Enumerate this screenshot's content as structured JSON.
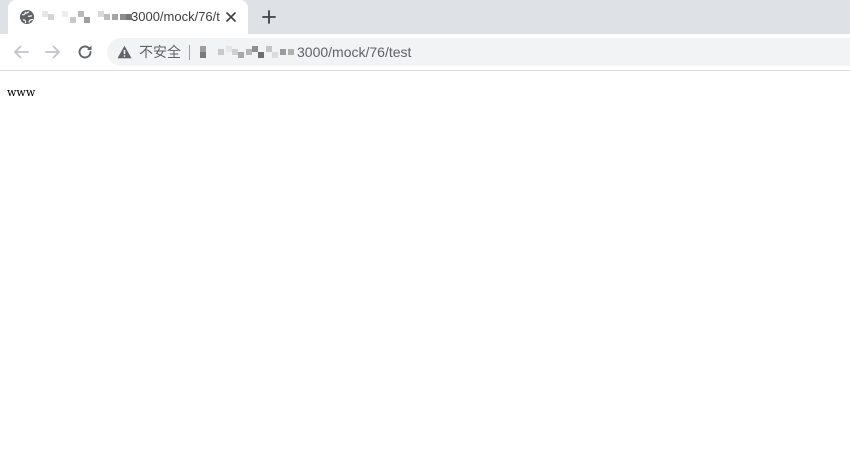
{
  "tab": {
    "title": "3000/mock/76/t",
    "favicon": "globe-icon",
    "close_icon": "close-icon"
  },
  "new_tab_icon": "plus-icon",
  "toolbar": {
    "back_icon": "arrow-left-icon",
    "forward_icon": "arrow-right-icon",
    "reload_icon": "reload-icon"
  },
  "address_bar": {
    "security_icon": "warning-icon",
    "security_label": "不安全",
    "url_path": "3000/mock/76/test"
  },
  "page": {
    "body_text": "www"
  },
  "colors": {
    "tabstrip": "#dee1e6",
    "omnibox": "#f1f3f4",
    "icon": "#5f6368",
    "disabled_icon": "#c1c4c8"
  }
}
